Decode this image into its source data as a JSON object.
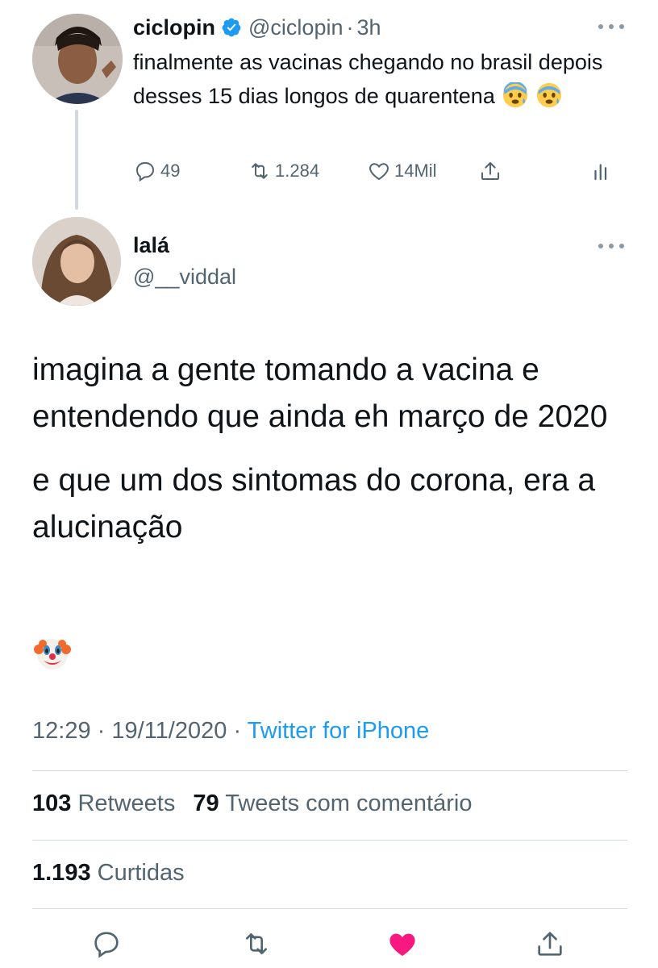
{
  "parent_tweet": {
    "name": "ciclopin",
    "handle": "@ciclopin",
    "separator": "·",
    "time": "3h",
    "text": "finalmente as vacinas chegando no brasil depois desses 15 dias longos de quarentena",
    "emojis": [
      "fearful-face-emoji",
      "fearful-face-emoji"
    ],
    "verified": true,
    "replies": "49",
    "retweets": "1.284",
    "likes": "14Mil"
  },
  "main_tweet": {
    "name": "lalá",
    "handle": "@__viddal",
    "paragraph_1": "imagina a gente tomando a vacina e entendendo que ainda eh março de 2020",
    "paragraph_2": "e que um dos sintomas do corona, era a alucinação",
    "emoji": "clown-face-emoji",
    "time": "12:29",
    "sep1": "·",
    "date": "19/11/2020",
    "sep2": "·",
    "source": "Twitter for iPhone",
    "retweet_count": "103",
    "retweet_label": "Retweets",
    "quote_count": "79",
    "quote_label": "Tweets com comentário",
    "like_count": "1.193",
    "like_label": "Curtidas",
    "liked": true
  },
  "colors": {
    "text": "#0f1419",
    "secondary": "#536471",
    "link": "#1d9bf0",
    "like_red": "#f91880",
    "divider": "#cfd9de"
  }
}
